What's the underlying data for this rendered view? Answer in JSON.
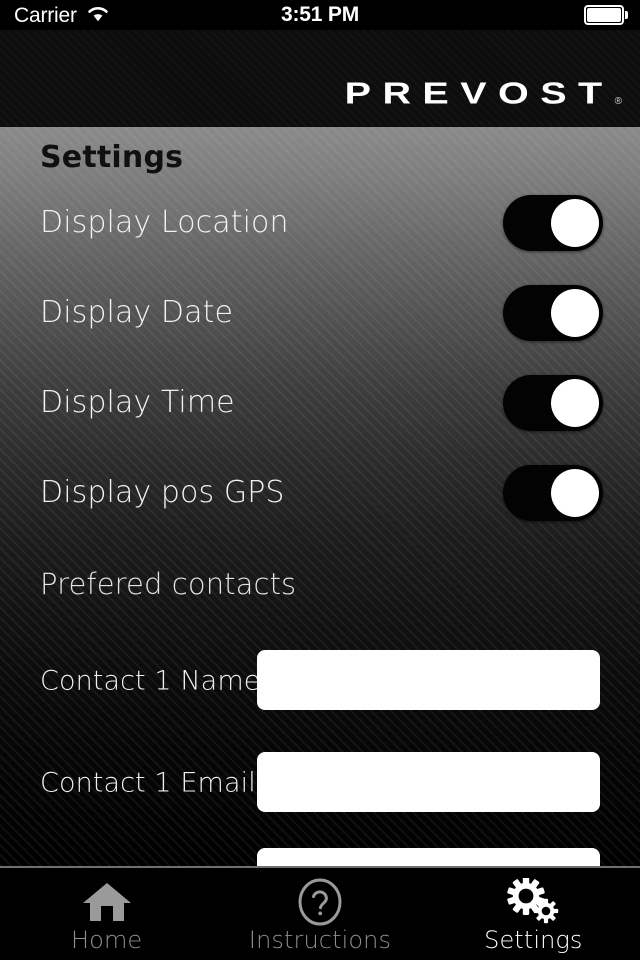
{
  "status_bar": {
    "carrier": "Carrier",
    "wifi_icon": "wifi-icon",
    "time": "3:51 PM",
    "battery_icon": "battery-full-icon"
  },
  "header": {
    "brand": "PREVOST",
    "trademark": "®"
  },
  "content": {
    "page_title": "Settings",
    "toggles": [
      {
        "label": "Display Location",
        "state": "on"
      },
      {
        "label": "Display Date",
        "state": "on"
      },
      {
        "label": "Display Time",
        "state": "on"
      },
      {
        "label": "Display pos GPS",
        "state": "on"
      }
    ],
    "contacts_heading": "Prefered contacts",
    "fields": [
      {
        "label": "Contact 1 Name",
        "value": "",
        "placeholder": ""
      },
      {
        "label": "Contact 1 Email",
        "value": "",
        "placeholder": ""
      },
      {
        "label": "",
        "value": "",
        "placeholder": ""
      }
    ]
  },
  "tab_bar": {
    "tabs": [
      {
        "label": "Home",
        "icon": "home-icon",
        "active": false
      },
      {
        "label": "Instructions",
        "icon": "question-mark-circle-icon",
        "active": false
      },
      {
        "label": "Settings",
        "icon": "gears-icon",
        "active": true
      }
    ]
  },
  "colors": {
    "background_top": "#8a8a8a",
    "background_bottom": "#000000",
    "bar_background": "#000000",
    "toggle_on_track": "#030303",
    "toggle_knob": "#ffffff",
    "input_background": "#ffffff",
    "active_tab": "#ffffff",
    "inactive_tab": "#8d8d8d"
  }
}
